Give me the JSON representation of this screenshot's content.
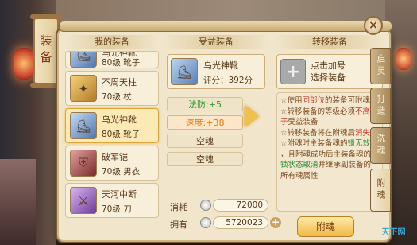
{
  "side_tab": "装备",
  "close_icon": "×",
  "columns": {
    "mine_title": "我的装备",
    "beneficiary_title": "受益装备",
    "transfer_title": "转移装备"
  },
  "my_equipment": [
    {
      "name": "乌光神靴",
      "meta": "80级  靴子",
      "icon": "boot-icon",
      "partial": true
    },
    {
      "name": "不周天柱",
      "meta": "70级  杖",
      "icon": "staff-icon"
    },
    {
      "name": "乌光神靴",
      "meta": "80级  靴子",
      "icon": "boot-icon",
      "selected": true
    },
    {
      "name": "破军铠",
      "meta": "70级  男衣",
      "icon": "armor-icon"
    },
    {
      "name": "天河中断",
      "meta": "70级  刀",
      "icon": "blade-icon"
    }
  ],
  "beneficiary": {
    "name": "乌光神靴",
    "score": "评分：392分",
    "attributes": [
      {
        "label": "法防:+5",
        "style": "green"
      },
      {
        "label": "速度:+38",
        "style": "orange"
      },
      {
        "label": "空魂",
        "style": "plain"
      },
      {
        "label": "空魂",
        "style": "plain"
      }
    ]
  },
  "transfer": {
    "prompt_line1": "点击加号",
    "prompt_line2": "选择装备",
    "notes": [
      {
        "segs": [
          {
            "t": "☆使用",
            "c": ""
          },
          {
            "t": "同部位",
            "c": "em"
          },
          {
            "t": "的装备可附魂",
            "c": ""
          }
        ]
      },
      {
        "segs": [
          {
            "t": "☆转移装备的等级必须",
            "c": ""
          },
          {
            "t": "不高",
            "c": "em"
          }
        ]
      },
      {
        "segs": [
          {
            "t": "于",
            "c": "em"
          },
          {
            "t": "受益装备",
            "c": ""
          }
        ]
      },
      {
        "segs": [
          {
            "t": "☆转移装备将在附魂后",
            "c": ""
          },
          {
            "t": "消失",
            "c": "em"
          }
        ]
      },
      {
        "segs": [
          {
            "t": "☆附魂时主装备魂的",
            "c": ""
          },
          {
            "t": "锁无效",
            "c": "em2"
          }
        ]
      },
      {
        "segs": [
          {
            "t": "，且附魂成功后主装备魂的",
            "c": ""
          }
        ]
      },
      {
        "segs": [
          {
            "t": "锁状态取消",
            "c": "em2"
          },
          {
            "t": "并继承副装备的",
            "c": ""
          }
        ]
      },
      {
        "segs": [
          {
            "t": "所有魂属性",
            "c": ""
          }
        ]
      }
    ]
  },
  "cost": {
    "label": "消耗",
    "value": "72000"
  },
  "own": {
    "label": "拥有",
    "value": "5720023"
  },
  "fuhun_button": "附魂",
  "right_tabs": [
    "启灵",
    "打造",
    "洗魂",
    "附魂"
  ],
  "watermark": "天下网"
}
